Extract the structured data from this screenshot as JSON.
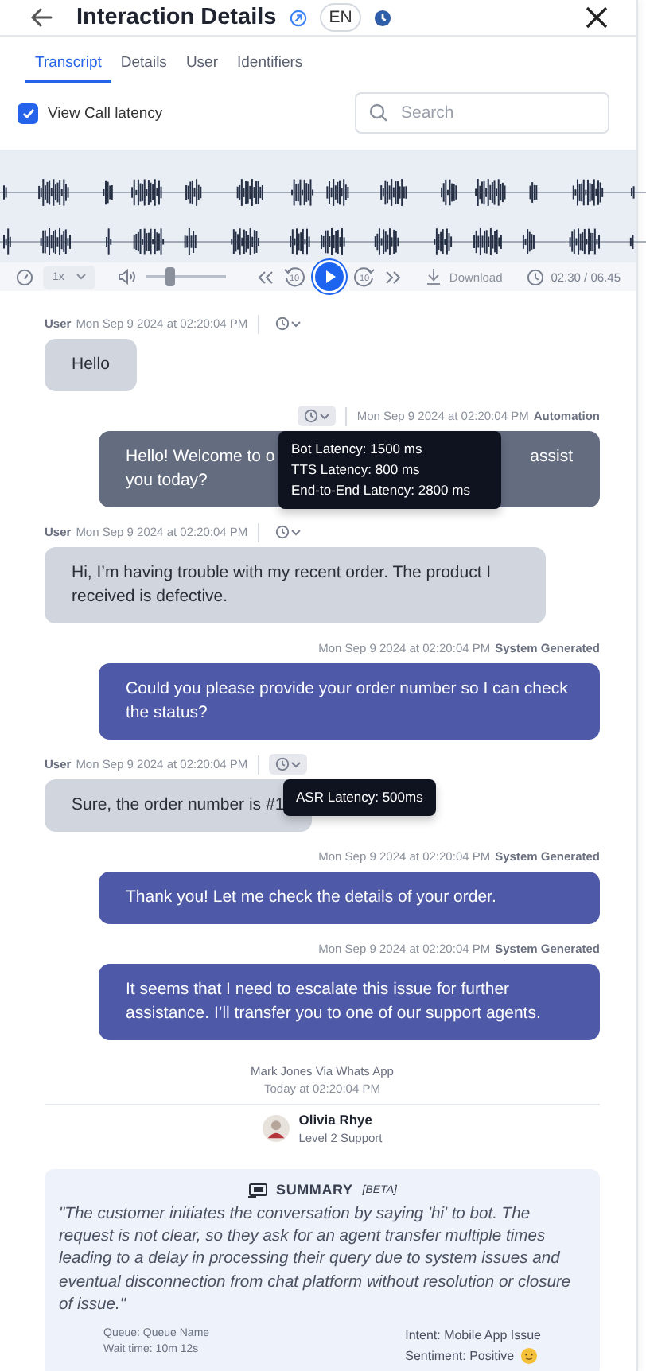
{
  "header": {
    "title": "Interaction Details",
    "language": "EN"
  },
  "tabs": [
    {
      "label": "Transcript",
      "selected": true
    },
    {
      "label": "Details",
      "selected": false
    },
    {
      "label": "User",
      "selected": false
    },
    {
      "label": "Identifiers",
      "selected": false
    }
  ],
  "latency_toggle": {
    "label": "View Call latency",
    "checked": true
  },
  "search": {
    "placeholder": "Search"
  },
  "player": {
    "speed": "1x",
    "volume": {
      "level": 0.3
    },
    "skip_back": "10",
    "skip_forward": "10",
    "download": "Download",
    "time": "02.30 / 06.45"
  },
  "messages": [
    {
      "kind": "user",
      "sender": "User",
      "time": "Mon Sep 9 2024 at 02:20:04 PM",
      "latency_button": true,
      "lines": [
        [
          "Hello"
        ]
      ]
    },
    {
      "kind": "automation",
      "sender": "Automation",
      "time": "Mon Sep 9 2024 at 02:20:04 PM",
      "latency_button": true,
      "lines": [
        [
          "Hello! Welcome to o",
          "assist"
        ],
        [
          "you today?"
        ]
      ],
      "tooltip": [
        "Bot Latency: 1500 ms",
        "TTS Latency: 800 ms",
        "End-to-End Latency: 2800 ms"
      ]
    },
    {
      "kind": "user",
      "sender": "User",
      "time": "Mon Sep 9 2024 at 02:20:04 PM",
      "latency_button": true,
      "lines": [
        [
          "Hi, I’m having trouble with my recent order. The product I received is defective."
        ]
      ]
    },
    {
      "kind": "system",
      "sender": "System Generated",
      "time": "Mon Sep 9 2024 at 02:20:04 PM",
      "latency_button": false,
      "lines": [
        [
          "Could you please provide your order number so I can check the status?"
        ]
      ]
    },
    {
      "kind": "user",
      "sender": "User",
      "time": "Mon Sep 9 2024 at 02:20:04 PM",
      "latency_button": true,
      "lines": [
        [
          "Sure, the order number is #1"
        ]
      ],
      "tooltip": [
        "ASR Latency: 500ms"
      ]
    },
    {
      "kind": "system",
      "sender": "System Generated",
      "time": "Mon Sep 9 2024 at 02:20:04 PM",
      "latency_button": false,
      "lines": [
        [
          "Thank you! Let me check the details of your order."
        ]
      ]
    },
    {
      "kind": "system",
      "sender": "System Generated",
      "time": "Mon Sep 9 2024 at 02:20:04 PM",
      "latency_button": false,
      "lines": [
        [
          "It seems that I need to escalate this issue for further assistance. I’ll transfer you to one of our support agents."
        ]
      ]
    }
  ],
  "handoff": {
    "channel": "Mark Jones Via Whats App",
    "time": "Today at 02:20:04 PM",
    "agent_name": "Olivia Rhye",
    "agent_role": "Level 2 Support"
  },
  "summary": {
    "title": "SUMMARY",
    "badge": "[BETA]",
    "text": "\"The customer initiates the conversation by saying 'hi' to bot. The request is not clear, so they ask for an agent transfer multiple times leading to a delay in processing their query due to system issues and eventual disconnection from chat platform without resolution or closure of issue.\"",
    "left": [
      "Queue: Queue Name",
      "Wait time: 10m 12s"
    ],
    "right": [
      "Intent: Mobile App Issue",
      "Sentiment: Positive"
    ]
  }
}
